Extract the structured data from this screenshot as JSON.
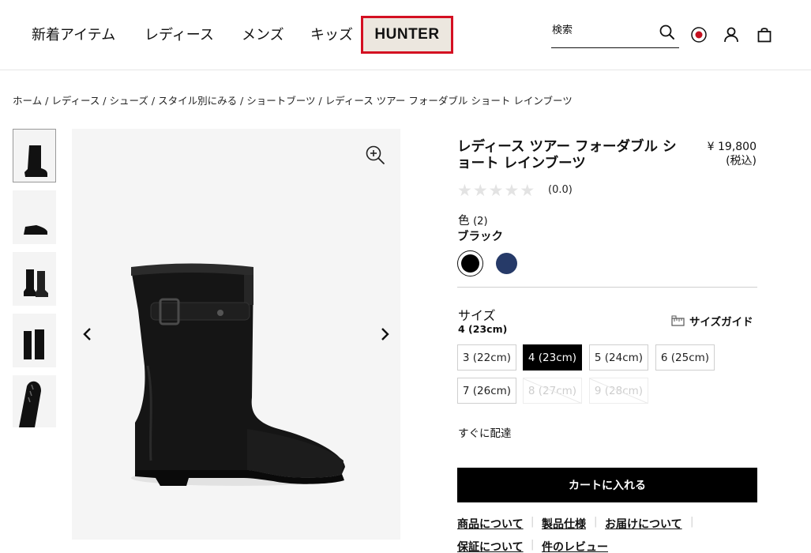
{
  "header": {
    "nav": [
      "新着アイテム",
      "レディース",
      "メンズ",
      "キッズ"
    ],
    "logo": "HUNTER",
    "search_placeholder": "検索",
    "icons": [
      "search-icon",
      "region-icon",
      "account-icon",
      "cart-icon"
    ]
  },
  "breadcrumb": [
    "ホーム",
    "レディース",
    "シューズ",
    "スタイル別にみる",
    "ショートブーツ",
    "レディース ツアー フォーダブル ショート レインブーツ"
  ],
  "product": {
    "title": "レディース ツアー フォーダブル ショート レインブーツ",
    "price": "¥ 19,800",
    "tax_note": "(税込)",
    "rating_text": "(0.0)",
    "rating_value": 0,
    "color_label": "色",
    "color_count": "(2)",
    "color_name": "ブラック",
    "colors": [
      "#000000",
      "#263a68"
    ]
  },
  "size": {
    "label": "サイズ",
    "selected": "4 (23cm)",
    "guide": "サイズガイド",
    "options": [
      "3 (22cm)",
      "4 (23cm)",
      "5 (24cm)",
      "6 (25cm)",
      "7 (26cm)",
      "8 (27cm)",
      "9 (28cm)"
    ],
    "available": [
      true,
      true,
      true,
      true,
      true,
      false,
      false
    ]
  },
  "shipping_text": "すぐに配達",
  "cart_button": "カートに入れる",
  "info_links": [
    "商品について",
    "製品仕様",
    "お届けについて",
    "保証について",
    "件のレビュー"
  ],
  "accent": "#d40f22"
}
